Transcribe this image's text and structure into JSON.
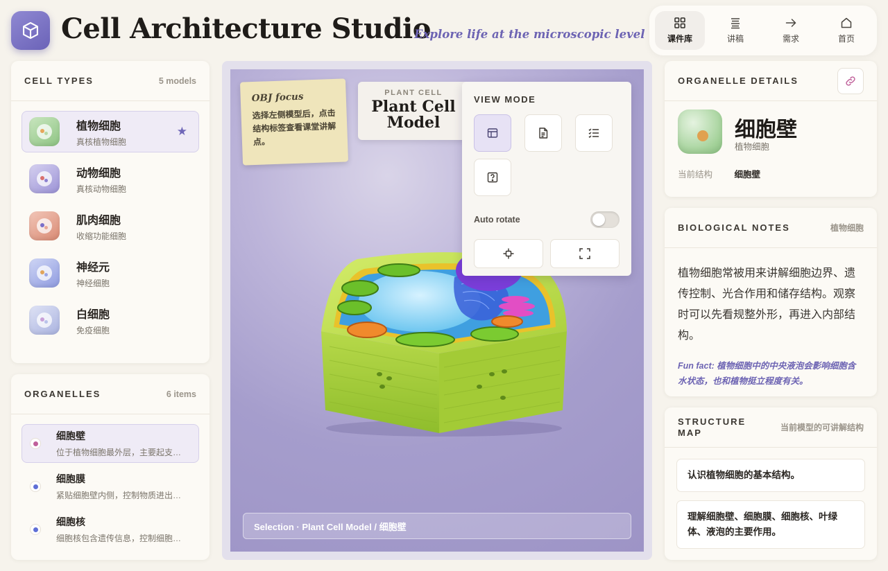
{
  "app": {
    "title": "Cell Architecture Studio",
    "tagline": "Explore life at the microscopic level"
  },
  "nav": [
    {
      "label": "课件库",
      "icon": "grid-icon",
      "active": true
    },
    {
      "label": "讲稿",
      "icon": "lines-icon",
      "active": false
    },
    {
      "label": "需求",
      "icon": "arrow-right-icon",
      "active": false
    },
    {
      "label": "首页",
      "icon": "home-icon",
      "active": false
    }
  ],
  "cell_types": {
    "title": "CELL TYPES",
    "count": "5 models",
    "items": [
      {
        "name": "植物细胞",
        "sub": "真核植物细胞",
        "active": true,
        "starred": true
      },
      {
        "name": "动物细胞",
        "sub": "真核动物细胞"
      },
      {
        "name": "肌肉细胞",
        "sub": "收缩功能细胞"
      },
      {
        "name": "神经元",
        "sub": "神经细胞"
      },
      {
        "name": "白细胞",
        "sub": "免疫细胞"
      }
    ]
  },
  "organelles": {
    "title": "ORGANELLES",
    "count": "6 items",
    "items": [
      {
        "name": "细胞壁",
        "desc": "位于植物细胞最外层，主要起支持和保护作用。",
        "color": "#c0609a",
        "active": true
      },
      {
        "name": "细胞膜",
        "desc": "紧贴细胞壁内侧，控制物质进出细胞。",
        "color": "#5f6fd6"
      },
      {
        "name": "细胞核",
        "desc": "细胞核包含遗传信息，控制细胞的生命活动。",
        "color": "#5f6fd6"
      }
    ]
  },
  "stage": {
    "sticky_title": "OBJ focus",
    "sticky_body": "选择左侧模型后，点击结构标签查看课堂讲解点。",
    "model_kicker": "PLANT CELL",
    "model_title": "Plant Cell Model",
    "selection": "Selection · Plant Cell Model / 细胞壁"
  },
  "view_mode": {
    "title": "VIEW MODE",
    "buttons": [
      "layout-icon",
      "document-icon",
      "checklist-icon",
      "question-icon"
    ],
    "auto_rotate_label": "Auto rotate",
    "auto_rotate": false
  },
  "details": {
    "title": "ORGANELLE DETAILS",
    "name": "细胞壁",
    "cell": "植物细胞",
    "current_label": "当前结构",
    "current_value": "细胞壁"
  },
  "notes": {
    "title": "BIOLOGICAL NOTES",
    "tag": "植物细胞",
    "body": "植物细胞常被用来讲解细胞边界、遗传控制、光合作用和储存结构。观察时可以先看规整外形，再进入内部结构。",
    "fun_fact": "Fun fact: 植物细胞中的中央液泡会影响细胞含水状态，也和植物挺立程度有关。"
  },
  "structure_map": {
    "title": "STRUCTURE MAP",
    "meta": "当前模型的可讲解结构",
    "items": [
      "认识植物细胞的基本结构。",
      "理解细胞壁、细胞膜、细胞核、叶绿体、液泡的主要作用。"
    ]
  },
  "colors": {
    "accent": "#6d64b3",
    "background": "#f6f3ec",
    "panel": "#fcfaf5"
  }
}
